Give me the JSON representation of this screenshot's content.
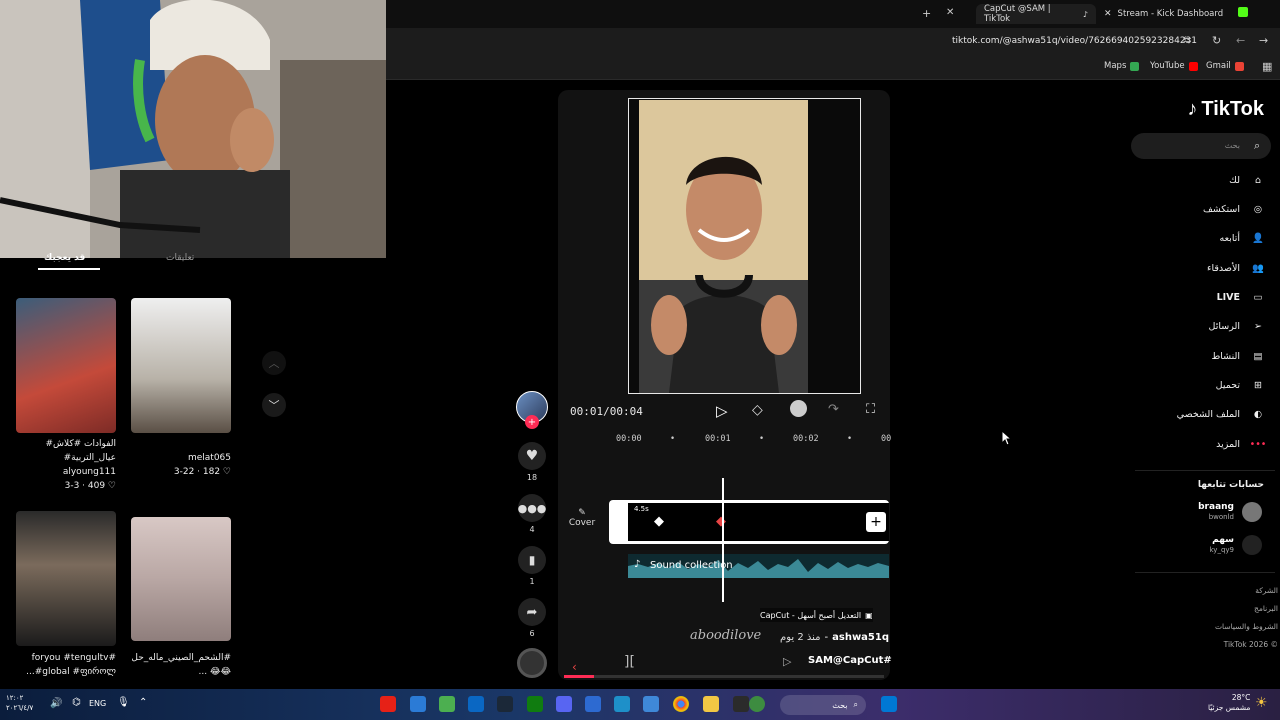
{
  "browser": {
    "tabs": [
      {
        "label": "CapCut @SAM | TikTok",
        "active": true
      },
      {
        "label": "Stream - Kick Dashboard",
        "active": false
      }
    ],
    "url": "tiktok.com/@ashwa51q/video/7626694025923284231",
    "bookmarks": [
      {
        "label": "Maps",
        "color": "#34a853"
      },
      {
        "label": "YouTube",
        "color": "#ff0000"
      },
      {
        "label": "Gmail",
        "color": "#ea4335"
      }
    ]
  },
  "left_feed": {
    "tabs": [
      "قد يعجبك",
      "تعليقات"
    ],
    "items": [
      {
        "caption1": "#الفوادات #كلاش",
        "caption2": "#عيال_التربية",
        "author": "alyoung111",
        "meta": "3-3 · 409 ♡"
      },
      {
        "caption1": "",
        "caption2": "",
        "author": "melat065",
        "meta": "3-22 · 182 ♡"
      },
      {
        "caption1": "foryou #tengultv#",
        "caption2": "...#global #ფიროლ",
        "author": "",
        "meta": ""
      },
      {
        "caption1": "الشحم_الصيني_ماله_حل#",
        "caption2": "... 😂😂",
        "author": "",
        "meta": ""
      }
    ]
  },
  "tiktok": {
    "logo": "TikTok",
    "search_placeholder": "بحث",
    "nav": [
      {
        "label": "لك",
        "icon": "home-icon"
      },
      {
        "label": "استكشف",
        "icon": "compass-icon"
      },
      {
        "label": "أتابعه",
        "icon": "user-follow-icon"
      },
      {
        "label": "الأصدقاء",
        "icon": "friends-icon"
      },
      {
        "label": "LIVE",
        "icon": "live-icon"
      },
      {
        "label": "الرسائل",
        "icon": "send-icon"
      },
      {
        "label": "النشاط",
        "icon": "inbox-icon"
      },
      {
        "label": "تحميل",
        "icon": "upload-icon"
      },
      {
        "label": "الملف الشخصي",
        "icon": "profile-icon"
      },
      {
        "label": "المزيد",
        "icon": "more-icon"
      }
    ],
    "following_title": "حسابات تتابعها",
    "following": [
      {
        "name": "braang",
        "handle": "bwonld"
      },
      {
        "name": "سهم",
        "handle": "ky_qy9"
      }
    ],
    "footer": [
      "الشركة",
      "البرنامج",
      "الشروط والسياسات",
      "TikTok 2026 ©"
    ]
  },
  "editor": {
    "timecode": "00:01/00:04",
    "ruler": [
      "00:00",
      "00:01",
      "00:02",
      "00"
    ],
    "clip_duration": "4.5s",
    "cover_label": "Cover",
    "sound_label": "Sound collection"
  },
  "post": {
    "capcut_tag": "CapCut - التعديل أصبح أسهل",
    "author": "ashwa51q",
    "date": "منذ 2 يوم",
    "watermark": "aboodilove",
    "hashtag": "SAM@CapCut#"
  },
  "actions": [
    {
      "name": "like",
      "count": "18"
    },
    {
      "name": "comment",
      "count": "4"
    },
    {
      "name": "bookmark",
      "count": "1"
    },
    {
      "name": "share",
      "count": "6"
    }
  ],
  "taskbar": {
    "lang": "ENG",
    "time": "۱۲:۰۲",
    "date": "٢٠٢٦/٤/٧",
    "weather": "28°C",
    "weather_desc": "مشمس جزئيًا",
    "search_label": "بحث"
  }
}
